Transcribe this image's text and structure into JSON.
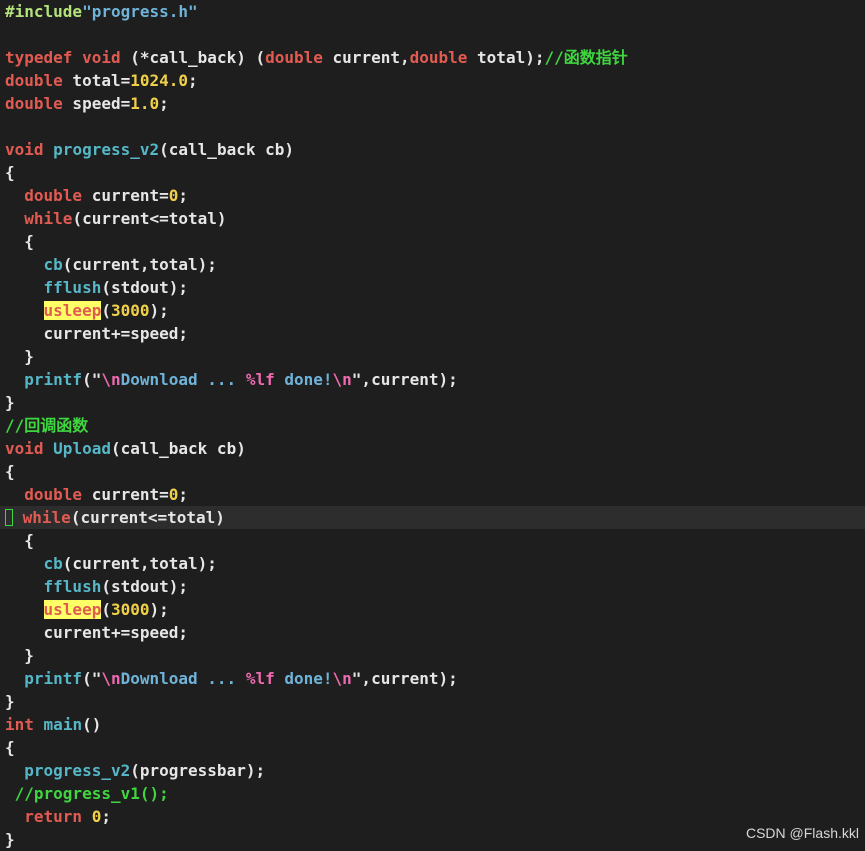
{
  "theme": {
    "background": "#1e1e1e",
    "current_line": "#2d2d2d",
    "colors": {
      "preprocessor": "#b4e37c",
      "string": "#6fb3d9",
      "keyword": "#e25b52",
      "function": "#55b7c7",
      "number": "#f0d048",
      "escape": "#ee6ab0",
      "comment": "#3fd63f",
      "text": "#e6e6e6",
      "highlight_bg": "#ffff66"
    }
  },
  "cursor_line": 22,
  "lines": [
    [
      [
        "pre",
        "#include"
      ],
      [
        "str",
        "\"progress.h\""
      ]
    ],
    [],
    [
      [
        "kw",
        "typedef"
      ],
      [
        "txt",
        " "
      ],
      [
        "kw",
        "void"
      ],
      [
        "txt",
        " (*call_back) ("
      ],
      [
        "kw",
        "double"
      ],
      [
        "txt",
        " current,"
      ],
      [
        "kw",
        "double"
      ],
      [
        "txt",
        " total);"
      ],
      [
        "cmt",
        "//函数指针"
      ]
    ],
    [
      [
        "kw",
        "double"
      ],
      [
        "txt",
        " total="
      ],
      [
        "num",
        "1024.0"
      ],
      [
        "txt",
        ";"
      ]
    ],
    [
      [
        "kw",
        "double"
      ],
      [
        "txt",
        " speed="
      ],
      [
        "num",
        "1.0"
      ],
      [
        "txt",
        ";"
      ]
    ],
    [],
    [
      [
        "kw",
        "void"
      ],
      [
        "txt",
        " "
      ],
      [
        "fn",
        "progress_v2"
      ],
      [
        "txt",
        "(call_back cb)"
      ]
    ],
    [
      [
        "txt",
        "{"
      ]
    ],
    [
      [
        "txt",
        "  "
      ],
      [
        "kw",
        "double"
      ],
      [
        "txt",
        " current="
      ],
      [
        "num",
        "0"
      ],
      [
        "txt",
        ";"
      ]
    ],
    [
      [
        "txt",
        "  "
      ],
      [
        "kw",
        "while"
      ],
      [
        "txt",
        "(current<=total)"
      ]
    ],
    [
      [
        "txt",
        "  {"
      ]
    ],
    [
      [
        "txt",
        "    "
      ],
      [
        "fn",
        "cb"
      ],
      [
        "txt",
        "(current,total);"
      ]
    ],
    [
      [
        "txt",
        "    "
      ],
      [
        "fn",
        "fflush"
      ],
      [
        "txt",
        "(stdout);"
      ]
    ],
    [
      [
        "txt",
        "    "
      ],
      [
        "hl",
        "usleep"
      ],
      [
        "txt",
        "("
      ],
      [
        "num",
        "3000"
      ],
      [
        "txt",
        ");"
      ]
    ],
    [
      [
        "txt",
        "    current+=speed;"
      ]
    ],
    [
      [
        "txt",
        "  }"
      ]
    ],
    [
      [
        "txt",
        "  "
      ],
      [
        "fn",
        "printf"
      ],
      [
        "txt",
        "(\""
      ],
      [
        "esc",
        "\\n"
      ],
      [
        "str",
        "Download ... "
      ],
      [
        "esc",
        "%lf"
      ],
      [
        "str",
        " done!"
      ],
      [
        "esc",
        "\\n"
      ],
      [
        "txt",
        "\",current);"
      ]
    ],
    [
      [
        "txt",
        "}"
      ]
    ],
    [
      [
        "cmt",
        "//回调函数"
      ]
    ],
    [
      [
        "kw",
        "void"
      ],
      [
        "txt",
        " "
      ],
      [
        "fn",
        "Upload"
      ],
      [
        "txt",
        "(call_back cb)"
      ]
    ],
    [
      [
        "txt",
        "{"
      ]
    ],
    [
      [
        "txt",
        "  "
      ],
      [
        "kw",
        "double"
      ],
      [
        "txt",
        " current="
      ],
      [
        "num",
        "0"
      ],
      [
        "txt",
        ";"
      ]
    ],
    [
      [
        "cur",
        ""
      ],
      [
        "txt",
        " "
      ],
      [
        "kw",
        "while"
      ],
      [
        "txt",
        "(current<=total)"
      ]
    ],
    [
      [
        "txt",
        "  {"
      ]
    ],
    [
      [
        "txt",
        "    "
      ],
      [
        "fn",
        "cb"
      ],
      [
        "txt",
        "(current,total);"
      ]
    ],
    [
      [
        "txt",
        "    "
      ],
      [
        "fn",
        "fflush"
      ],
      [
        "txt",
        "(stdout);"
      ]
    ],
    [
      [
        "txt",
        "    "
      ],
      [
        "hl",
        "usleep"
      ],
      [
        "txt",
        "("
      ],
      [
        "num",
        "3000"
      ],
      [
        "txt",
        ");"
      ]
    ],
    [
      [
        "txt",
        "    current+=speed;"
      ]
    ],
    [
      [
        "txt",
        "  }"
      ]
    ],
    [
      [
        "txt",
        "  "
      ],
      [
        "fn",
        "printf"
      ],
      [
        "txt",
        "(\""
      ],
      [
        "esc",
        "\\n"
      ],
      [
        "str",
        "Download ... "
      ],
      [
        "esc",
        "%lf"
      ],
      [
        "str",
        " done!"
      ],
      [
        "esc",
        "\\n"
      ],
      [
        "txt",
        "\",current);"
      ]
    ],
    [
      [
        "txt",
        "}"
      ]
    ],
    [
      [
        "kw",
        "int"
      ],
      [
        "txt",
        " "
      ],
      [
        "fn",
        "main"
      ],
      [
        "txt",
        "()"
      ]
    ],
    [
      [
        "txt",
        "{"
      ]
    ],
    [
      [
        "txt",
        "  "
      ],
      [
        "fn",
        "progress_v2"
      ],
      [
        "txt",
        "(progressbar);"
      ]
    ],
    [
      [
        "txt",
        " "
      ],
      [
        "cmt",
        "//progress_v1();"
      ]
    ],
    [
      [
        "txt",
        "  "
      ],
      [
        "kw",
        "return"
      ],
      [
        "txt",
        " "
      ],
      [
        "num",
        "0"
      ],
      [
        "txt",
        ";"
      ]
    ],
    [
      [
        "txt",
        "}"
      ]
    ]
  ],
  "watermark": "CSDN @Flash.kkl"
}
